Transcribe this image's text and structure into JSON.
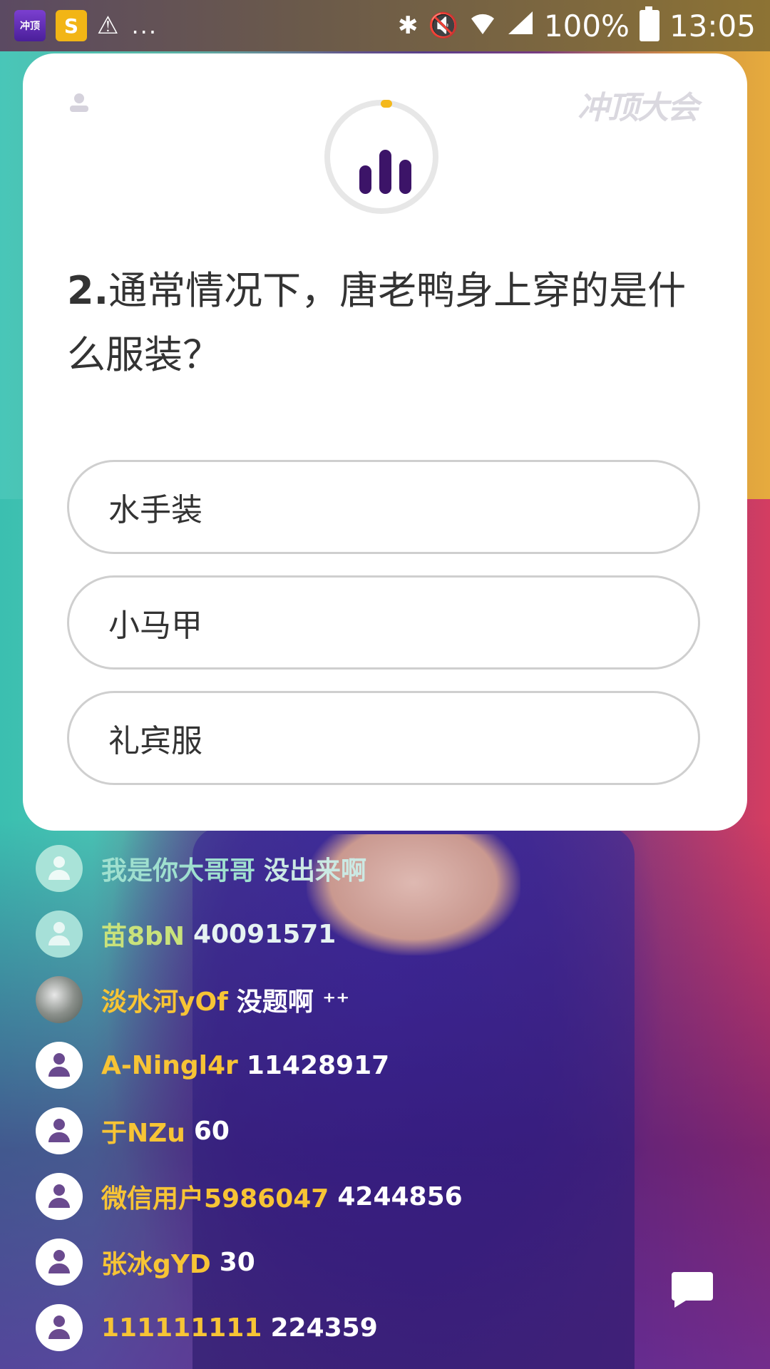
{
  "status_bar": {
    "app_icon_1": "冲顶",
    "app_icon_2": "S",
    "warning": "⚠",
    "overflow": "...",
    "battery": "100%",
    "time": "13:05"
  },
  "card": {
    "logo": "冲顶大会",
    "question_number": "2.",
    "question_text": "通常情况下，唐老鸭身上穿的是什么服装？",
    "options": [
      "水手装",
      "小马甲",
      "礼宾服"
    ]
  },
  "chat": [
    {
      "name": "我是你大哥哥",
      "text": "没出来啊"
    },
    {
      "name": "苗8bN",
      "text": "40091571"
    },
    {
      "name": "淡水河yOf",
      "text": "没题啊 ⁺⁺"
    },
    {
      "name": "A-Ningl4r",
      "text": "11428917"
    },
    {
      "name": "于NZu",
      "text": "60"
    },
    {
      "name": "微信用户5986047",
      "text": "4244856"
    },
    {
      "name": "张冰gYD",
      "text": "30"
    },
    {
      "name": "111111111",
      "text": "224359"
    }
  ],
  "colors": {
    "accent_yellow": "#f4b81b",
    "bars_purple": "#3c1468",
    "chat_name": "#f7c435"
  },
  "icons": [
    "bluetooth-icon",
    "mute-icon",
    "wifi-icon",
    "signal-icon",
    "battery-icon",
    "user-icon",
    "chat-icon"
  ]
}
